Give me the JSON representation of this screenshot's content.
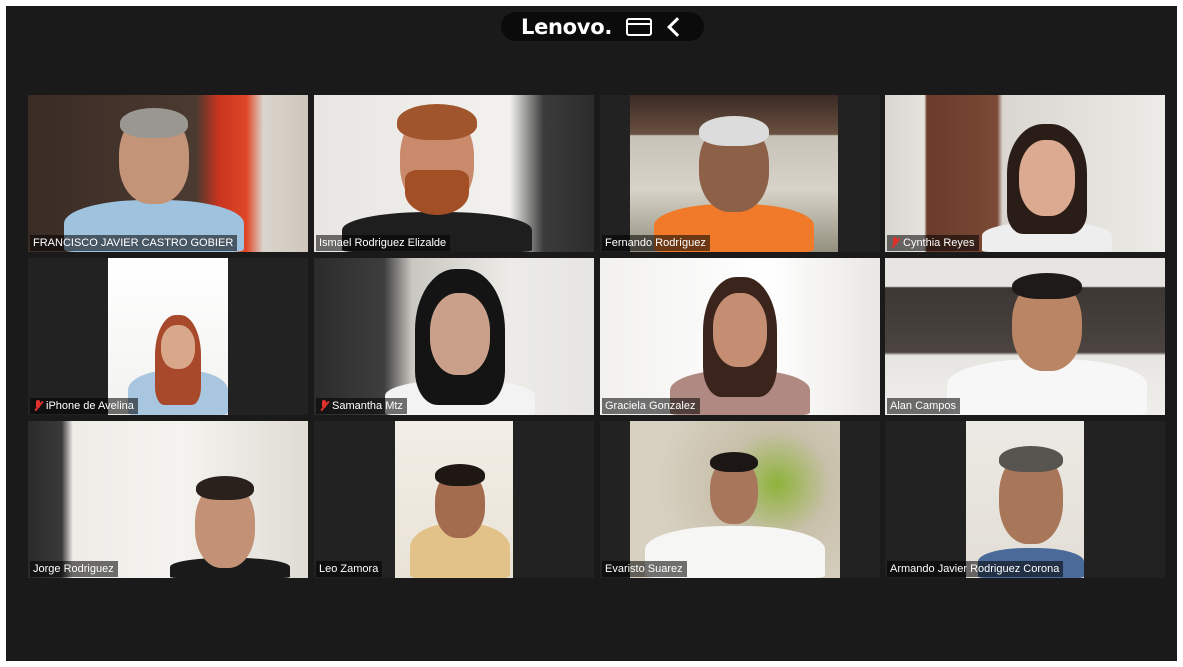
{
  "top_bar": {
    "brand": "Lenovo."
  },
  "participants": [
    {
      "name": "FRANCISCO JAVIER CASTRO GOBIER",
      "muted": false
    },
    {
      "name": "Ismael Rodriguez Elizalde",
      "muted": false
    },
    {
      "name": "Fernando Rodríguez",
      "muted": false
    },
    {
      "name": "Cynthia Reyes",
      "muted": true
    },
    {
      "name": "iPhone de Avelina",
      "muted": true
    },
    {
      "name": "Samantha Mtz",
      "muted": true
    },
    {
      "name": "Graciela Gonzalez",
      "muted": false
    },
    {
      "name": "Alan Campos",
      "muted": false,
      "active_speaker": true
    },
    {
      "name": "Jorge Rodriguez",
      "muted": false
    },
    {
      "name": "Leo Zamora",
      "muted": false
    },
    {
      "name": "Evaristo Suarez",
      "muted": false
    },
    {
      "name": "Armando Javier Rodriguez Corona",
      "muted": false
    }
  ],
  "colors": {
    "background": "#1a1a1a",
    "active_speaker_border": "#c9dc55",
    "muted_icon": "#e0312b"
  }
}
